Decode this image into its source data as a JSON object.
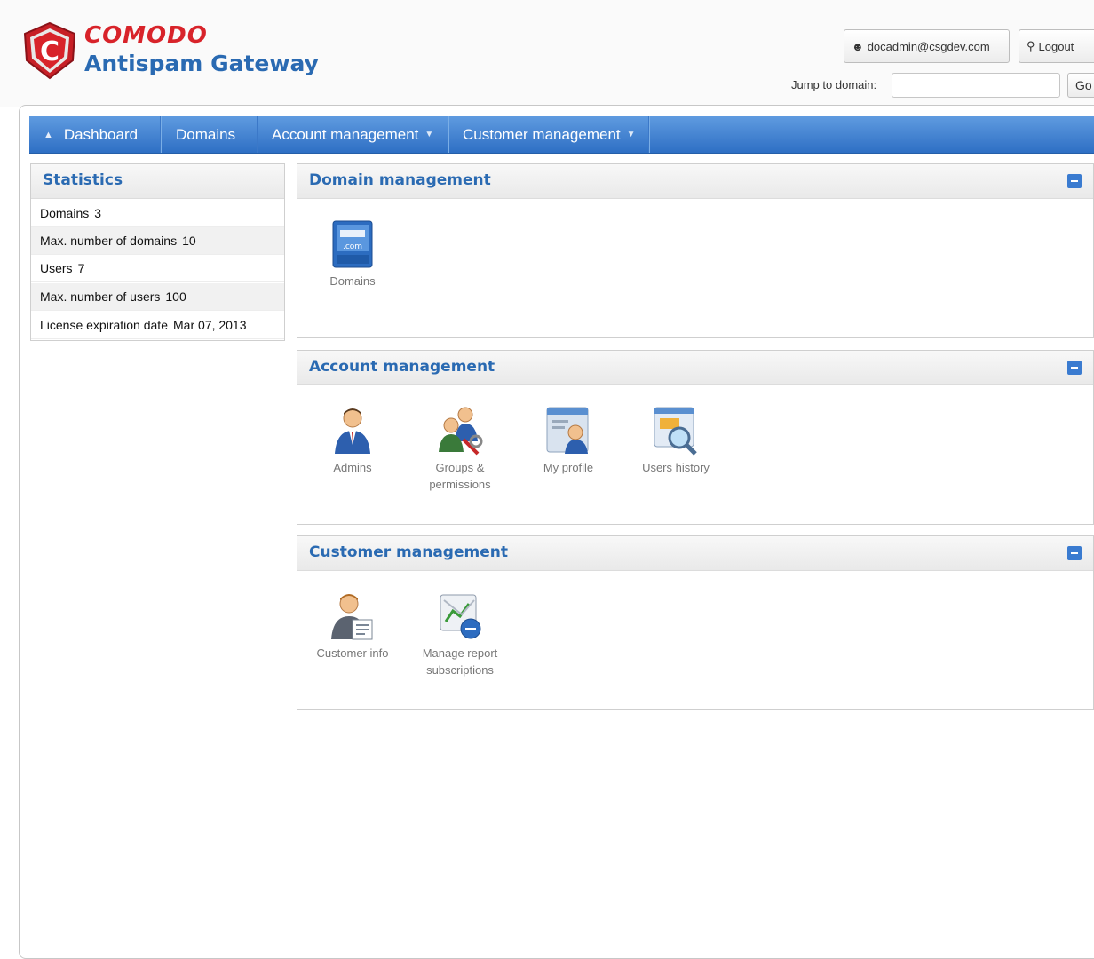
{
  "brand": {
    "company": "COMODO",
    "product": "Antispam Gateway"
  },
  "header": {
    "user_label": "docadmin@csgdev.com",
    "logout_label": "Logout",
    "jump_label": "Jump to domain:",
    "jump_value": "",
    "go_label": "Go"
  },
  "nav": {
    "dashboard": "Dashboard",
    "domains": "Domains",
    "account_management": "Account management",
    "customer_management": "Customer management"
  },
  "statistics": {
    "title": "Statistics",
    "rows": [
      {
        "label": "Domains",
        "value": "3"
      },
      {
        "label": "Max. number of domains",
        "value": "10"
      },
      {
        "label": "Users",
        "value": "7"
      },
      {
        "label": "Max. number of users",
        "value": "100"
      },
      {
        "label": "License expiration date",
        "value": "Mar 07, 2013"
      }
    ]
  },
  "panels": {
    "domain_management": {
      "title": "Domain management",
      "items": [
        {
          "label": "Domains",
          "icon": "domains-icon"
        }
      ]
    },
    "account_management": {
      "title": "Account management",
      "items": [
        {
          "label": "Admins",
          "icon": "admins-icon"
        },
        {
          "label": "Groups &",
          "label2": "permissions",
          "icon": "groups-permissions-icon"
        },
        {
          "label": "My profile",
          "icon": "my-profile-icon"
        },
        {
          "label": "Users history",
          "icon": "users-history-icon"
        }
      ]
    },
    "customer_management": {
      "title": "Customer management",
      "items": [
        {
          "label": "Customer info",
          "icon": "customer-info-icon"
        },
        {
          "label": "Manage report",
          "label2": "subscriptions",
          "icon": "manage-report-subscriptions-icon"
        }
      ]
    }
  },
  "colors": {
    "brand_red": "#d8232a",
    "brand_blue": "#2a6ab2",
    "nav_blue": "#2e6fc4"
  }
}
